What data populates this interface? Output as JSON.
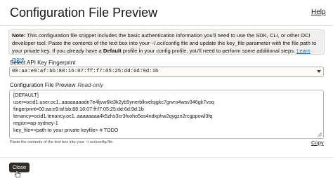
{
  "dialog": {
    "title": "Configuration File Preview",
    "help_link": "Help"
  },
  "note": {
    "label": "Note:",
    "text_1": " This configuration file snippet includes the basic authentication information you'll need to use the SDK, CLI, or other OCI developer tool. Paste the contents of the text box into your ~/.oci/config file and update the key_file parameter with the file path to your private key. If you already have a ",
    "default_word": "Default",
    "text_2": " profile in your config profile, you'll need to perform some additional steps. ",
    "learn_more": "Learn more"
  },
  "fingerprint": {
    "label": "Select API Key Fingerprint",
    "value": "00:aa:e9:af:bb:88:16:07:ff:f7:05:25:dd:6d:9d:1b"
  },
  "config": {
    "label": "Configuration File Preview",
    "read_only": "Read-only",
    "content": "[DEFAULT]\nuser=ocid1.user.oc1..aaaaaaaadn7e4ljvw6kt3k2yb5ynerblkvelsjgkc7grvro4wsv346gk7voq\nfingerprint=00:aa:e9:af:bb:88:16:07:ff:f7:05:25:dd:6d:9d:1b\ntenancy=ocid1.tenancy.oc1..aaaaaaaa4k5zhs3cr3fvoho5os4ndxphw2qygzn2rcgppowl3fq\nregion=ap-sydney-1\nkey_file=<path to your private keyfile> # TODO",
    "hint": "Paste the contents of the text box into your ~/.oci/config file.",
    "copy_label": "Copy"
  },
  "footer": {
    "close_label": "Close"
  },
  "icons": {
    "dropdown": "chevron-down-icon",
    "cursor": "hand-pointer-icon",
    "resize": "resize-grip-icon"
  },
  "colors": {
    "link": "#0572ce",
    "button_bg": "#312d2a",
    "note_bg": "#f1efed"
  }
}
